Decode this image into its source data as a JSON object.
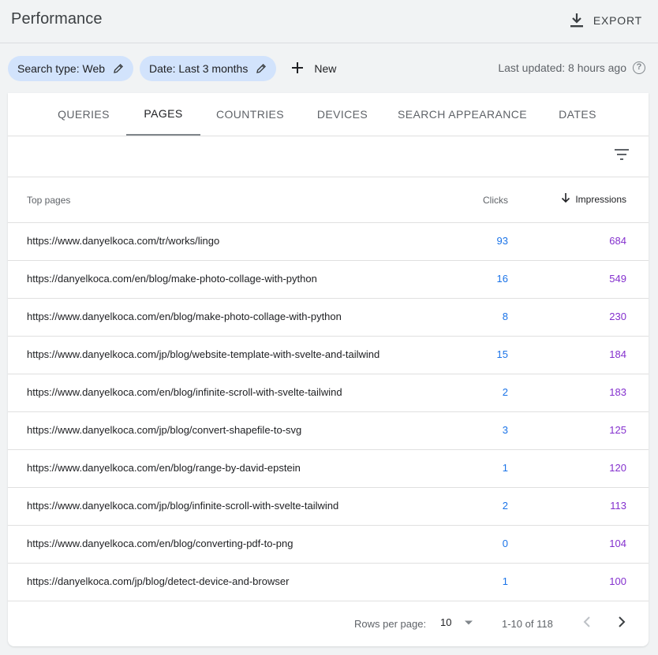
{
  "header": {
    "title": "Performance",
    "export_label": "EXPORT"
  },
  "filters": {
    "search_type": "Search type: Web",
    "date": "Date: Last 3 months",
    "new_label": "New",
    "last_updated": "Last updated: 8 hours ago"
  },
  "tabs": [
    {
      "label": "QUERIES"
    },
    {
      "label": "PAGES",
      "active": true
    },
    {
      "label": "COUNTRIES"
    },
    {
      "label": "DEVICES"
    },
    {
      "label": "SEARCH APPEARANCE"
    },
    {
      "label": "DATES"
    }
  ],
  "table": {
    "headers": {
      "page": "Top pages",
      "clicks": "Clicks",
      "impressions": "Impressions"
    },
    "rows": [
      {
        "url": "https://www.danyelkoca.com/tr/works/lingo",
        "clicks": "93",
        "impressions": "684"
      },
      {
        "url": "https://danyelkoca.com/en/blog/make-photo-collage-with-python",
        "clicks": "16",
        "impressions": "549"
      },
      {
        "url": "https://www.danyelkoca.com/en/blog/make-photo-collage-with-python",
        "clicks": "8",
        "impressions": "230"
      },
      {
        "url": "https://www.danyelkoca.com/jp/blog/website-template-with-svelte-and-tailwind",
        "clicks": "15",
        "impressions": "184"
      },
      {
        "url": "https://www.danyelkoca.com/en/blog/infinite-scroll-with-svelte-tailwind",
        "clicks": "2",
        "impressions": "183"
      },
      {
        "url": "https://www.danyelkoca.com/jp/blog/convert-shapefile-to-svg",
        "clicks": "3",
        "impressions": "125"
      },
      {
        "url": "https://www.danyelkoca.com/en/blog/range-by-david-epstein",
        "clicks": "1",
        "impressions": "120"
      },
      {
        "url": "https://www.danyelkoca.com/jp/blog/infinite-scroll-with-svelte-tailwind",
        "clicks": "2",
        "impressions": "113"
      },
      {
        "url": "https://www.danyelkoca.com/en/blog/converting-pdf-to-png",
        "clicks": "0",
        "impressions": "104"
      },
      {
        "url": "https://danyelkoca.com/jp/blog/detect-device-and-browser",
        "clicks": "1",
        "impressions": "100"
      }
    ]
  },
  "pagination": {
    "rows_per_page_label": "Rows per page:",
    "rows_per_page_value": "10",
    "range_text": "1-10 of 118"
  },
  "colors": {
    "clicks": "#1a73e8",
    "impressions": "#8430ce",
    "chip_bg": "#d2e3fc"
  },
  "icons": [
    "download-icon",
    "edit-pencil-icon",
    "plus-icon",
    "help-icon",
    "filter-list-icon",
    "arrow-down-icon",
    "dropdown-arrow-icon",
    "chevron-left-icon",
    "chevron-right-icon"
  ]
}
